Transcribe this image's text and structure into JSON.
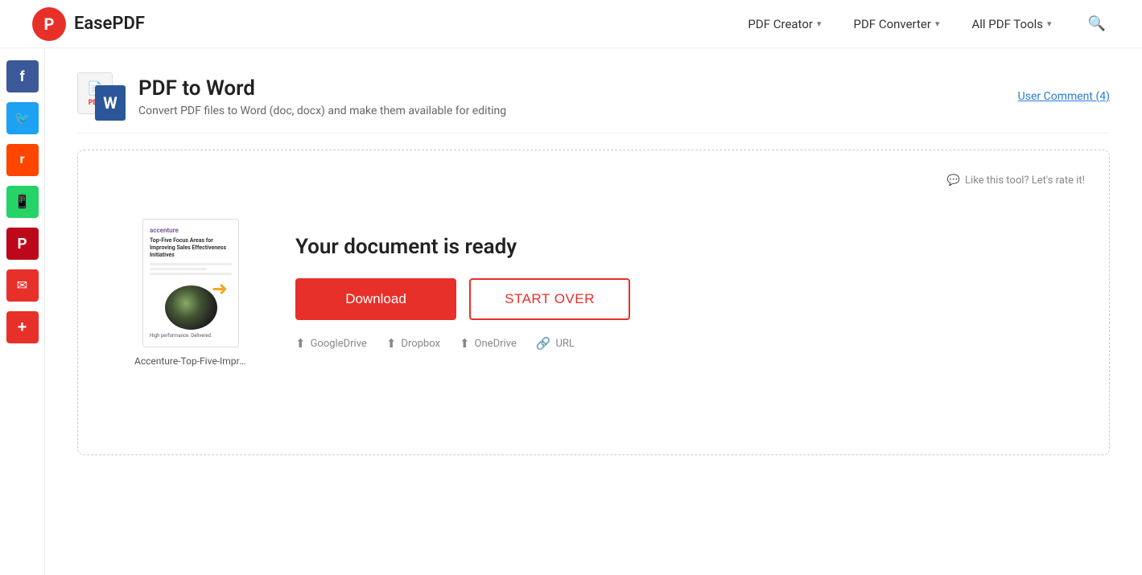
{
  "header": {
    "logo_letter": "P",
    "logo_name": "EasePDF",
    "nav": [
      {
        "label": "PDF Creator",
        "id": "pdf-creator"
      },
      {
        "label": "PDF Converter",
        "id": "pdf-converter"
      },
      {
        "label": "All PDF Tools",
        "id": "all-pdf-tools"
      }
    ]
  },
  "sidebar": {
    "items": [
      {
        "label": "Facebook",
        "icon": "f",
        "id": "facebook"
      },
      {
        "label": "Twitter",
        "icon": "🐦",
        "id": "twitter"
      },
      {
        "label": "Reddit",
        "icon": "r",
        "id": "reddit"
      },
      {
        "label": "WhatsApp",
        "icon": "w",
        "id": "whatsapp"
      },
      {
        "label": "Pinterest",
        "icon": "p",
        "id": "pinterest"
      },
      {
        "label": "Email",
        "icon": "✉",
        "id": "email"
      },
      {
        "label": "More",
        "icon": "+",
        "id": "more"
      }
    ]
  },
  "page": {
    "title": "PDF to Word",
    "subtitle": "Convert PDF files to Word (doc, docx) and make them available for editing",
    "user_comment_label": "User Comment (4)"
  },
  "card": {
    "feedback_label": "Like this tool? Let's rate it!",
    "doc_filename": "Accenture-Top-Five-Improvem...",
    "ready_title": "Your document is ready",
    "download_label": "Download",
    "start_over_label": "START OVER",
    "cloud_options": [
      {
        "label": "GoogleDrive",
        "icon": "⬆",
        "id": "googledrive"
      },
      {
        "label": "Dropbox",
        "icon": "⬆",
        "id": "dropbox"
      },
      {
        "label": "OneDrive",
        "icon": "⬆",
        "id": "onedrive"
      },
      {
        "label": "URL",
        "icon": "🔗",
        "id": "url"
      }
    ]
  }
}
